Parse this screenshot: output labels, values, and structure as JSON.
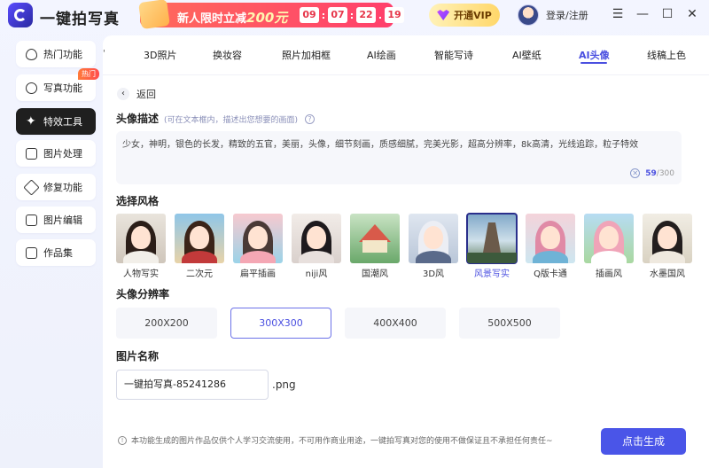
{
  "app": {
    "title": "一键拍写真"
  },
  "promo": {
    "text": "新人限时立减",
    "amount": "200元",
    "countdown": [
      "09",
      "07",
      "22",
      "19"
    ]
  },
  "header": {
    "vip_label": "开通VIP",
    "login_label": "登录/注册"
  },
  "sidebar": {
    "items": [
      {
        "label": "热门功能",
        "icon": "fire-icon"
      },
      {
        "label": "写真功能",
        "icon": "portrait-icon",
        "badge": "热门"
      },
      {
        "label": "特效工具",
        "icon": "sparkle-icon",
        "active": true
      },
      {
        "label": "图片处理",
        "icon": "image-icon"
      },
      {
        "label": "修复功能",
        "icon": "wrench-icon"
      },
      {
        "label": "图片编辑",
        "icon": "edit-icon"
      },
      {
        "label": "作品集",
        "icon": "gallery-icon"
      }
    ]
  },
  "tabs": {
    "items": [
      "3D照片",
      "换妆容",
      "照片加相框",
      "AI绘画",
      "智能写诗",
      "AI壁纸",
      "AI头像",
      "线稿上色"
    ],
    "active": "AI头像"
  },
  "main": {
    "back_label": "返回",
    "desc_title": "头像描述",
    "desc_hint": "(可在文本框内，描述出您想要的画面)",
    "desc_text": "少女，神明，银色的长发，精致的五官，美丽，头像，细节刻画，质感细腻，完美光影，超高分辨率，8k高清，光线追踪，粒子特效",
    "char_count": "59",
    "char_max": "/300",
    "style_title": "选择风格",
    "styles": [
      "人物写实",
      "二次元",
      "扁平插画",
      "niji风",
      "国潮风",
      "3D风",
      "风景写实",
      "Q版卡通",
      "插画风",
      "水墨国风"
    ],
    "style_active": "风景写实",
    "res_title": "头像分辨率",
    "resolutions": [
      "200X200",
      "300X300",
      "400X400",
      "500X500"
    ],
    "res_active": "300X300",
    "name_title": "图片名称",
    "name_value": "一键拍写真-85241286",
    "name_ext": ".png",
    "disclaimer": "本功能生成的图片作品仅供个人学习交流使用，不可用作商业用途，一键拍写真对您的使用不做保证且不承担任何责任~",
    "generate_label": "点击生成"
  },
  "colors": {
    "accent": "#4a55e8",
    "active_tab": "#4a4fe0",
    "sidebar_active": "#1f1f1f",
    "promo": "#ff3f6c"
  }
}
